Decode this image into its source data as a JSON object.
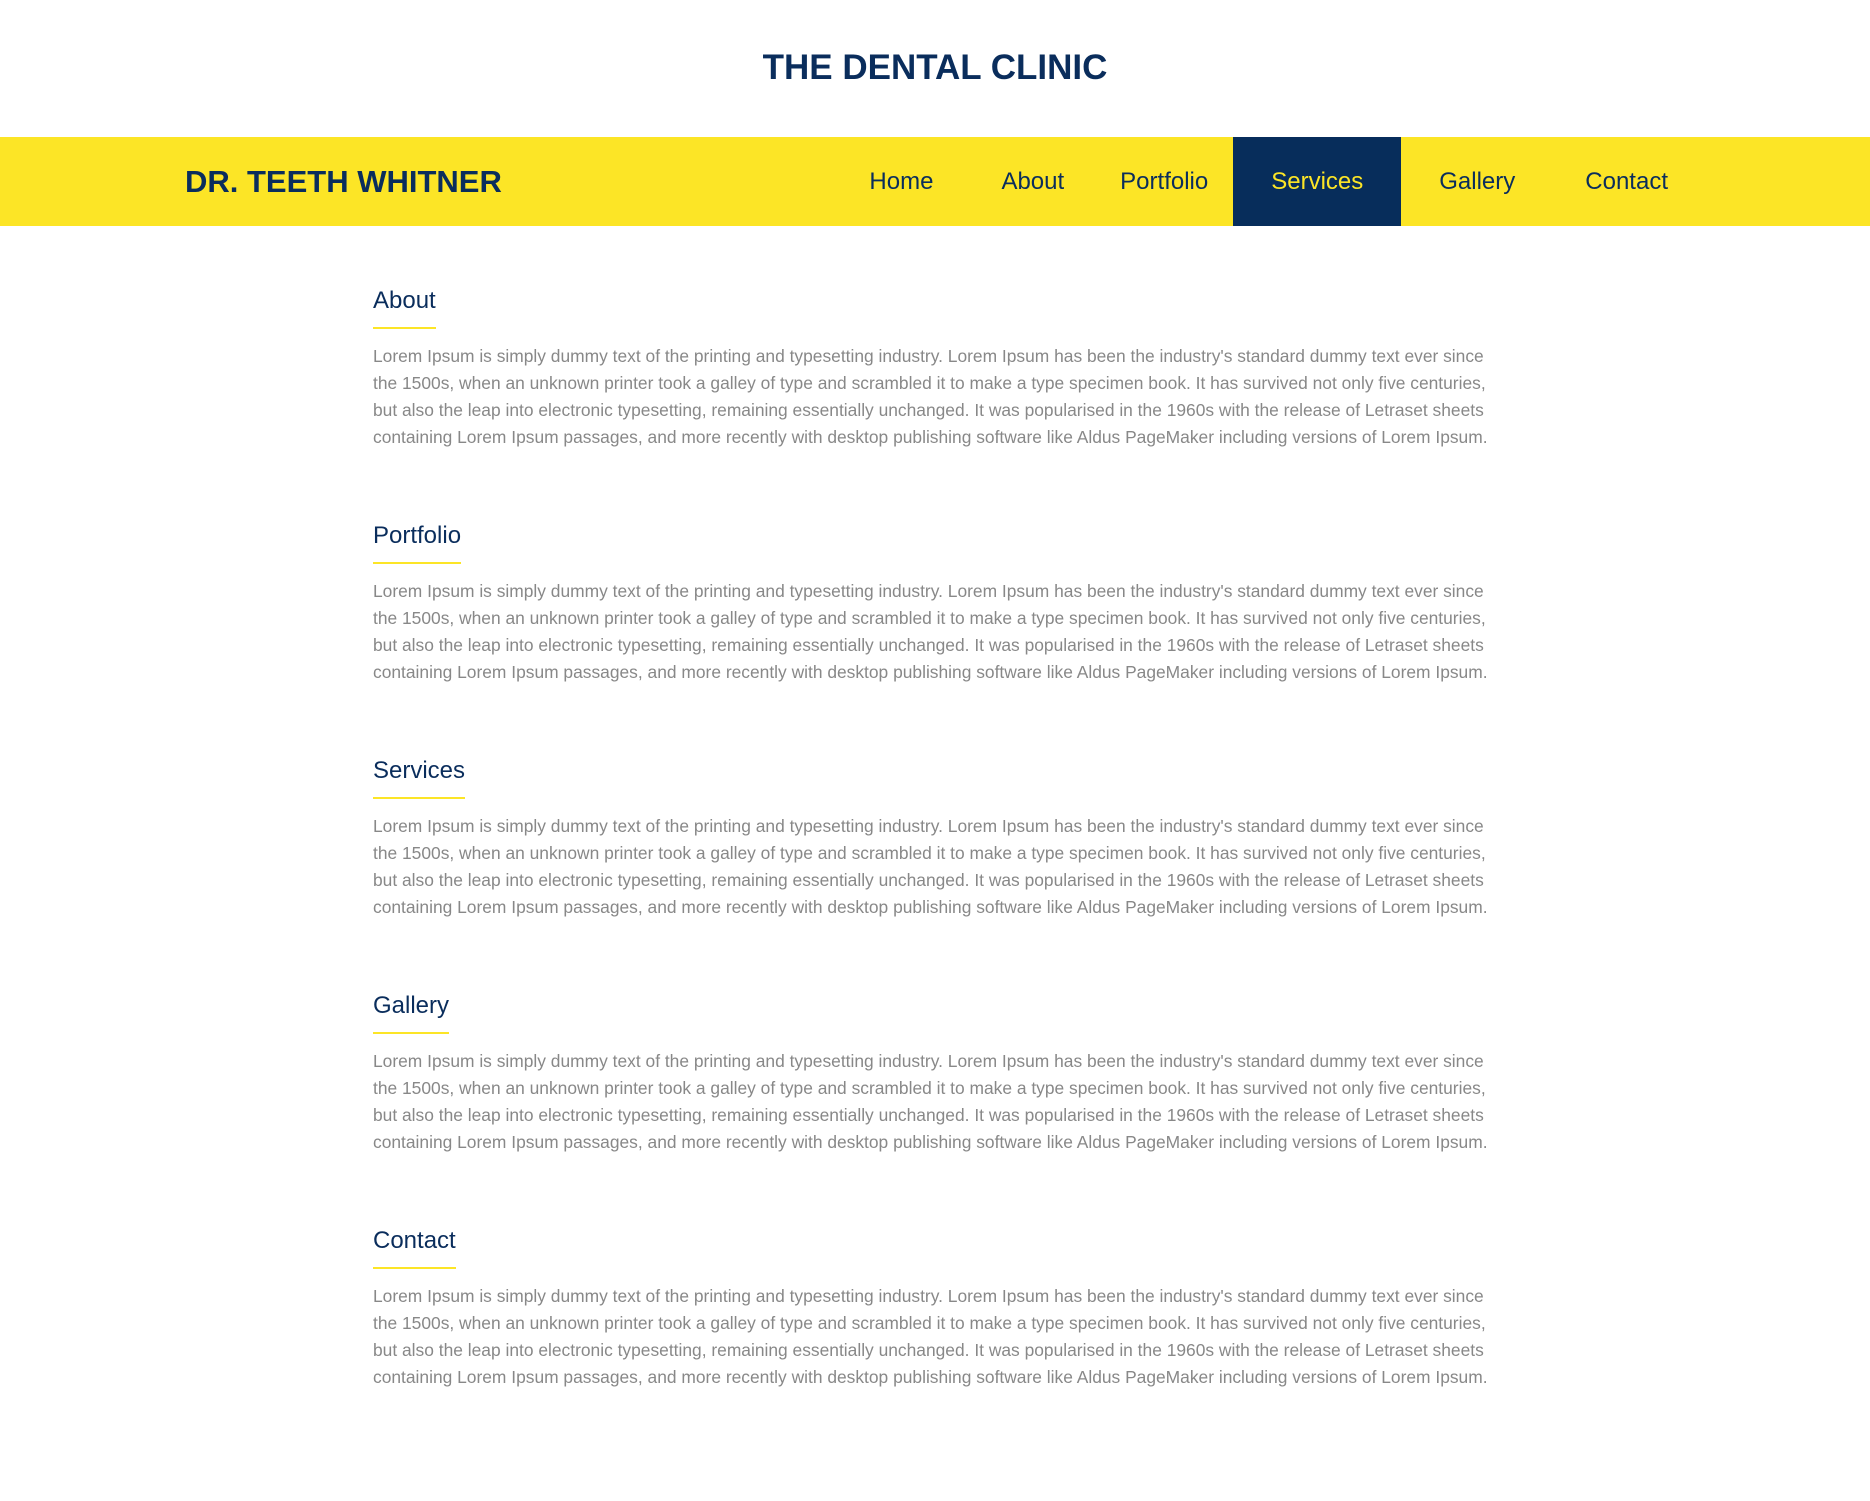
{
  "site": {
    "title": "THE DENTAL CLINIC"
  },
  "navbar": {
    "brand": "DR. TEETH WHITNER",
    "items": [
      {
        "label": "Home",
        "active": false
      },
      {
        "label": "About",
        "active": false
      },
      {
        "label": "Portfolio",
        "active": false
      },
      {
        "label": "Services",
        "active": true
      },
      {
        "label": "Gallery",
        "active": false
      },
      {
        "label": "Contact",
        "active": false
      }
    ]
  },
  "sections": [
    {
      "heading": "About",
      "text": "Lorem Ipsum is simply dummy text of the printing and typesetting industry. Lorem Ipsum has been the industry's standard dummy text ever since the 1500s, when an unknown printer took a galley of type and scrambled it to make a type specimen book. It has survived not only five centuries, but also the leap into electronic typesetting, remaining essentially unchanged. It was popularised in the 1960s with the release of Letraset sheets containing Lorem Ipsum passages, and more recently with desktop publishing software like Aldus PageMaker including versions of Lorem Ipsum."
    },
    {
      "heading": "Portfolio",
      "text": "Lorem Ipsum is simply dummy text of the printing and typesetting industry. Lorem Ipsum has been the industry's standard dummy text ever since the 1500s, when an unknown printer took a galley of type and scrambled it to make a type specimen book. It has survived not only five centuries, but also the leap into electronic typesetting, remaining essentially unchanged. It was popularised in the 1960s with the release of Letraset sheets containing Lorem Ipsum passages, and more recently with desktop publishing software like Aldus PageMaker including versions of Lorem Ipsum."
    },
    {
      "heading": "Services",
      "text": "Lorem Ipsum is simply dummy text of the printing and typesetting industry. Lorem Ipsum has been the industry's standard dummy text ever since the 1500s, when an unknown printer took a galley of type and scrambled it to make a type specimen book. It has survived not only five centuries, but also the leap into electronic typesetting, remaining essentially unchanged. It was popularised in the 1960s with the release of Letraset sheets containing Lorem Ipsum passages, and more recently with desktop publishing software like Aldus PageMaker including versions of Lorem Ipsum."
    },
    {
      "heading": "Gallery",
      "text": "Lorem Ipsum is simply dummy text of the printing and typesetting industry. Lorem Ipsum has been the industry's standard dummy text ever since the 1500s, when an unknown printer took a galley of type and scrambled it to make a type specimen book. It has survived not only five centuries, but also the leap into electronic typesetting, remaining essentially unchanged. It was popularised in the 1960s with the release of Letraset sheets containing Lorem Ipsum passages, and more recently with desktop publishing software like Aldus PageMaker including versions of Lorem Ipsum."
    },
    {
      "heading": "Contact",
      "text": "Lorem Ipsum is simply dummy text of the printing and typesetting industry. Lorem Ipsum has been the industry's standard dummy text ever since the 1500s, when an unknown printer took a galley of type and scrambled it to make a type specimen book. It has survived not only five centuries, but also the leap into electronic typesetting, remaining essentially unchanged. It was popularised in the 1960s with the release of Letraset sheets containing Lorem Ipsum passages, and more recently with desktop publishing software like Aldus PageMaker including versions of Lorem Ipsum."
    }
  ],
  "colors": {
    "accent_yellow": "#fce526",
    "navy": "#0a2d5c",
    "body_text": "#888888"
  }
}
